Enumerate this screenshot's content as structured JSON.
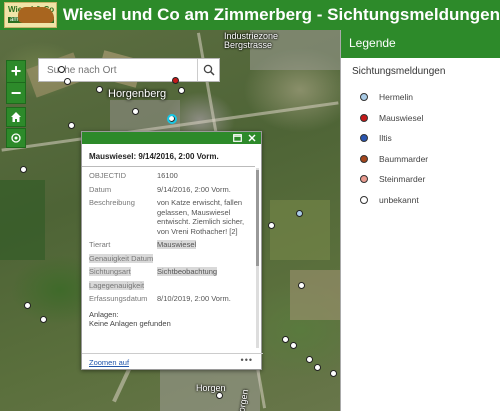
{
  "header": {
    "title": "Wiesel und Co am Zimmerberg - Sichtungsmeldungen",
    "logo_line1": "Wiesel & Co",
    "logo_line2": "am Zimmerberg"
  },
  "search": {
    "placeholder": "Suche nach Ort"
  },
  "map_controls": {
    "zoom_in": "+",
    "zoom_out": "−"
  },
  "map_labels": {
    "place": "Horgenberg",
    "area": "Industriezone Bergstrasse",
    "bottom_a": "Horgen",
    "bottom_b": "Horgen"
  },
  "popup": {
    "heading": "Mauswiesel: 9/14/2016, 2:00 Vorm.",
    "fields": [
      {
        "key": "OBJECTID",
        "value": "16100"
      },
      {
        "key": "Datum",
        "value": "9/14/2016, 2:00 Vorm."
      },
      {
        "key": "Beschreibung",
        "value": "von Katze erwischt, fallen gelassen, Mauswiesel entwischt. Ziemlich sicher, von Vreni Rothacher! [2]"
      },
      {
        "key": "Tierart",
        "value": "Mauswiesel"
      },
      {
        "key": "Genauigkeit Datum",
        "value": ""
      },
      {
        "key": "Sichtungsart",
        "value": "Sichtbeobachtung"
      },
      {
        "key": "Lagegenauigkeit",
        "value": ""
      },
      {
        "key": "Erfassungsdatum",
        "value": "8/10/2019, 2:00 Vorm."
      }
    ],
    "attachments_label": "Anlagen:",
    "attachments_value": "Keine Anlagen gefunden",
    "zoom_link": "Zoomen auf",
    "more": "•••"
  },
  "legend": {
    "title": "Legende",
    "subtitle": "Sichtungsmeldungen",
    "items": [
      {
        "label": "Hermelin",
        "color": "#a9cbe6"
      },
      {
        "label": "Mauswiesel",
        "color": "#c41a1a"
      },
      {
        "label": "Iltis",
        "color": "#2a55b0"
      },
      {
        "label": "Baummarder",
        "color": "#a4461c"
      },
      {
        "label": "Steinmarder",
        "color": "#e89a8e"
      },
      {
        "label": "unbekannt",
        "color": "#ffffff"
      }
    ]
  }
}
